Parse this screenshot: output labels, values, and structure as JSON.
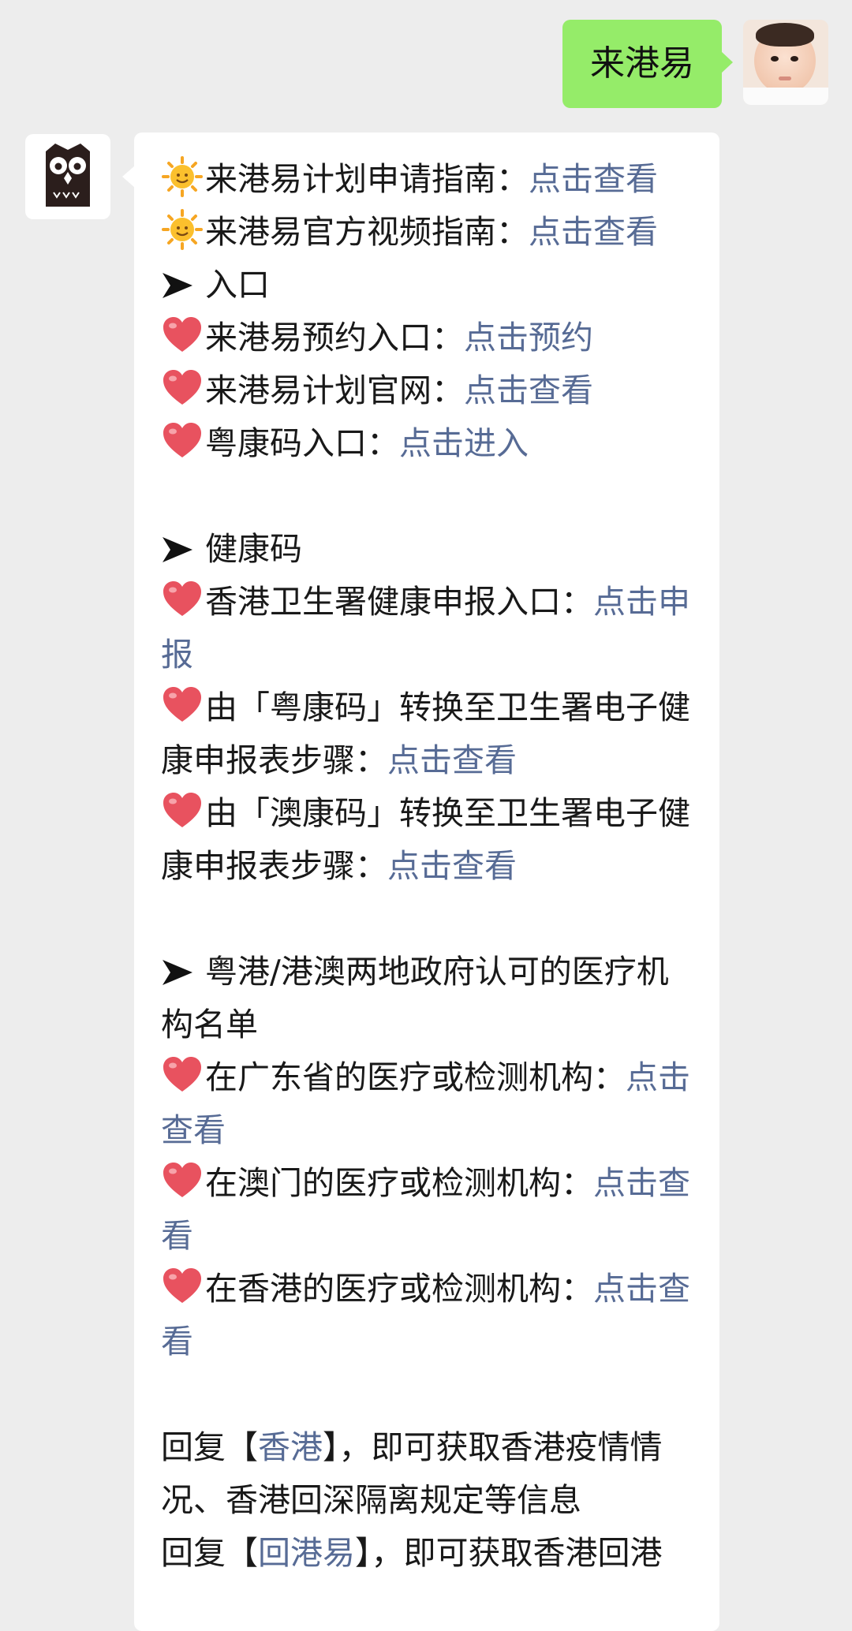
{
  "sent": {
    "text": "来港易"
  },
  "message": {
    "guide_plan": {
      "label": "来港易计划申请指南：",
      "link": "点击查看"
    },
    "guide_video": {
      "label": "来港易官方视频指南：",
      "link": "点击查看"
    },
    "section_entry": "入口",
    "entry_booking": {
      "label": "来港易预约入口：",
      "link": "点击预约"
    },
    "entry_site": {
      "label": "来港易计划官网：",
      "link": "点击查看"
    },
    "entry_yuekang": {
      "label": "粤康码入口：",
      "link": "点击进入"
    },
    "section_health": "健康码",
    "health_hk": {
      "label": "香港卫生署健康申报入口：",
      "link": "点击申报"
    },
    "health_yue_convert": {
      "label": "由「粤康码」转换至卫生署电子健康申报表步骤：",
      "link": "点击查看"
    },
    "health_ao_convert": {
      "label": "由「澳康码」转换至卫生署电子健康申报表步骤：",
      "link": "点击查看"
    },
    "section_medical": "粤港/港澳两地政府认可的医疗机构名单",
    "med_gd": {
      "label": "在广东省的医疗或检测机构：",
      "link": "点击查看"
    },
    "med_macau": {
      "label": "在澳门的医疗或检测机构：",
      "link": "点击查看"
    },
    "med_hk": {
      "label": "在香港的医疗或检测机构：",
      "link": "点击查看"
    },
    "reply_hk": {
      "prefix": "回复【",
      "keyword": "香港",
      "suffix": "】，即可获取香港疫情情况、香港回深隔离规定等信息"
    },
    "reply_back": {
      "prefix": "回复【",
      "keyword": "回港易",
      "suffix": "】，即可获取香港回港"
    }
  },
  "icons": {
    "sun": "sun-emoji-icon",
    "heart": "heart-emoji-icon",
    "arrow": "arrow-right-icon"
  },
  "colors": {
    "link": "#576b95",
    "sent_bubble": "#95ec69",
    "background": "#ededed"
  }
}
